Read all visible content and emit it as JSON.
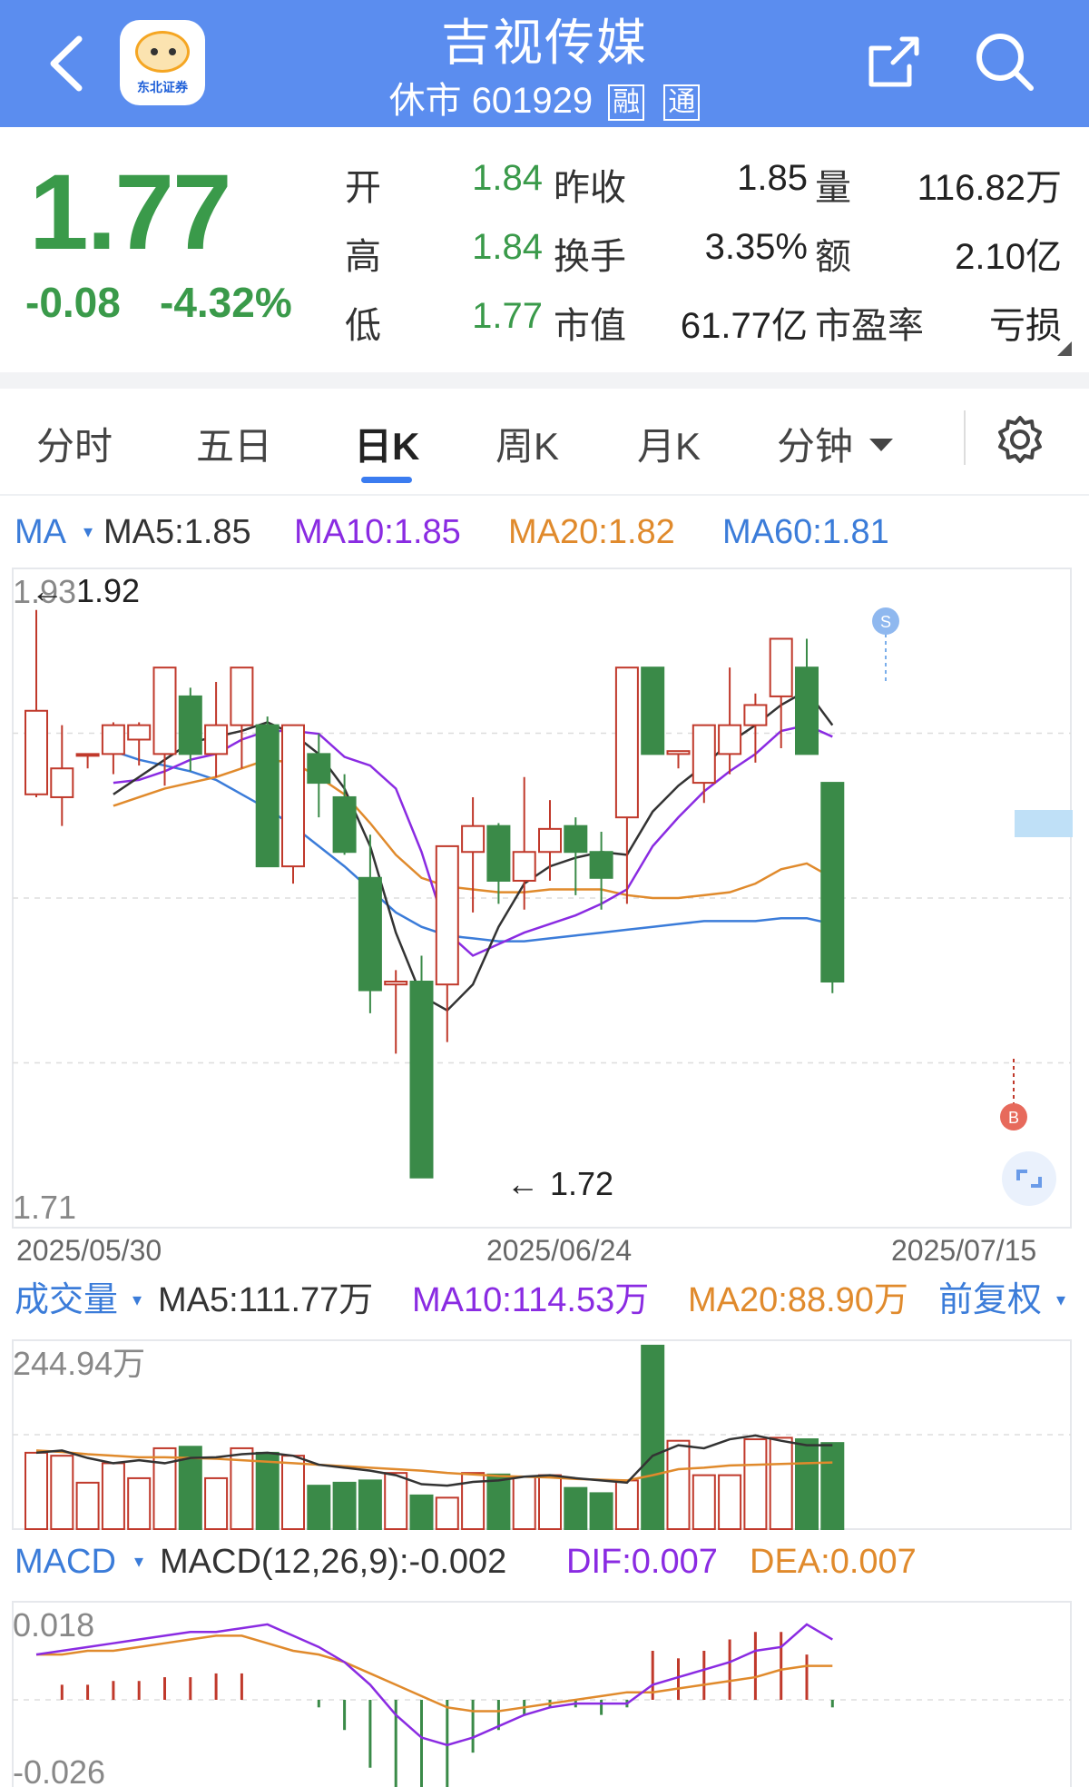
{
  "header": {
    "title": "吉视传媒",
    "status": "休市",
    "code": "601929",
    "tag1": "融",
    "tag2": "通",
    "logo_text": "东北证券"
  },
  "quote": {
    "price": "1.77",
    "change": "-0.08",
    "change_pct": "-4.32%",
    "rows": [
      {
        "l1": "开",
        "v1": "1.84",
        "l2": "昨收",
        "v2": "1.85",
        "l3": "量",
        "v3": "116.82万"
      },
      {
        "l1": "高",
        "v1": "1.84",
        "l2": "换手",
        "v2": "3.35%",
        "l3": "额",
        "v3": "2.10亿"
      },
      {
        "l1": "低",
        "v1": "1.77",
        "l2": "市值",
        "v2": "61.77亿",
        "l3": "市盈率",
        "v3": "亏损"
      }
    ]
  },
  "tabs": [
    "分时",
    "五日",
    "日K",
    "周K",
    "月K",
    "分钟"
  ],
  "active_tab": "日K",
  "colors": {
    "header": "#5b8def",
    "up": "#c0392b",
    "down": "#3a8a48",
    "ma5": "#333333",
    "ma10": "#8a2be2",
    "ma20": "#e08a2c",
    "ma60": "#3b7cd9",
    "accent": "#3b7cf0"
  },
  "kline_legend": {
    "label": "MA",
    "ma5": "MA5:1.85",
    "ma10": "MA10:1.85",
    "ma20": "MA20:1.82",
    "ma60": "MA60:1.81"
  },
  "volume_legend": {
    "label": "成交量",
    "ma5": "MA5:111.77万",
    "ma10": "MA10:114.53万",
    "ma20": "MA20:88.90万",
    "adjust": "前复权"
  },
  "macd_legend": {
    "label": "MACD",
    "macd": "MACD(12,26,9):-0.002",
    "dif": "DIF:0.007",
    "dea": "DEA:0.007"
  },
  "chart_data": {
    "type": "candlestick",
    "y_axis": {
      "top_label": "1.93",
      "bottom_label": "1.71",
      "min": 1.71,
      "max": 1.93
    },
    "x_labels": [
      "2025/05/30",
      "2025/06/24",
      "2025/07/15"
    ],
    "annotations": {
      "high": "1.92",
      "low": "1.72",
      "sell_marker": "S",
      "buy_marker": "B"
    },
    "candles": [
      {
        "o": 1.856,
        "h": 1.92,
        "l": 1.855,
        "c": 1.885
      },
      {
        "o": 1.855,
        "h": 1.88,
        "l": 1.845,
        "c": 1.865
      },
      {
        "o": 1.87,
        "h": 1.87,
        "l": 1.865,
        "c": 1.87
      },
      {
        "o": 1.87,
        "h": 1.881,
        "l": 1.863,
        "c": 1.88
      },
      {
        "o": 1.875,
        "h": 1.881,
        "l": 1.866,
        "c": 1.88
      },
      {
        "o": 1.87,
        "h": 1.89,
        "l": 1.859,
        "c": 1.9
      },
      {
        "o": 1.89,
        "h": 1.893,
        "l": 1.864,
        "c": 1.87
      },
      {
        "o": 1.87,
        "h": 1.895,
        "l": 1.862,
        "c": 1.88
      },
      {
        "o": 1.88,
        "h": 1.895,
        "l": 1.865,
        "c": 1.9
      },
      {
        "o": 1.88,
        "h": 1.883,
        "l": 1.837,
        "c": 1.831
      },
      {
        "o": 1.831,
        "h": 1.88,
        "l": 1.825,
        "c": 1.88
      },
      {
        "o": 1.87,
        "h": 1.877,
        "l": 1.848,
        "c": 1.86
      },
      {
        "o": 1.855,
        "h": 1.863,
        "l": 1.835,
        "c": 1.836
      },
      {
        "o": 1.827,
        "h": 1.842,
        "l": 1.78,
        "c": 1.788
      },
      {
        "o": 1.79,
        "h": 1.795,
        "l": 1.766,
        "c": 1.791
      },
      {
        "o": 1.791,
        "h": 1.8,
        "l": 1.743,
        "c": 1.723
      },
      {
        "o": 1.79,
        "h": 1.836,
        "l": 1.77,
        "c": 1.838
      },
      {
        "o": 1.836,
        "h": 1.855,
        "l": 1.815,
        "c": 1.845
      },
      {
        "o": 1.845,
        "h": 1.846,
        "l": 1.818,
        "c": 1.826
      },
      {
        "o": 1.826,
        "h": 1.862,
        "l": 1.816,
        "c": 1.836
      },
      {
        "o": 1.836,
        "h": 1.854,
        "l": 1.826,
        "c": 1.844
      },
      {
        "o": 1.845,
        "h": 1.848,
        "l": 1.821,
        "c": 1.836
      },
      {
        "o": 1.836,
        "h": 1.843,
        "l": 1.816,
        "c": 1.827
      },
      {
        "o": 1.848,
        "h": 1.9,
        "l": 1.818,
        "c": 1.9
      },
      {
        "o": 1.9,
        "h": 1.88,
        "l": 1.87,
        "c": 1.87
      },
      {
        "o": 1.87,
        "h": 1.87,
        "l": 1.865,
        "c": 1.871
      },
      {
        "o": 1.86,
        "h": 1.878,
        "l": 1.853,
        "c": 1.88
      },
      {
        "o": 1.87,
        "h": 1.9,
        "l": 1.863,
        "c": 1.88
      },
      {
        "o": 1.88,
        "h": 1.891,
        "l": 1.867,
        "c": 1.887
      },
      {
        "o": 1.89,
        "h": 1.91,
        "l": 1.872,
        "c": 1.91
      },
      {
        "o": 1.9,
        "h": 1.91,
        "l": 1.873,
        "c": 1.87
      },
      {
        "o": 1.86,
        "h": 1.855,
        "l": 1.787,
        "c": 1.791
      }
    ],
    "ma": {
      "ma5": [
        1.856,
        1.862,
        1.868,
        1.874,
        1.876,
        1.878,
        1.881,
        1.877,
        1.87,
        1.858,
        1.838,
        1.808,
        1.786,
        1.781,
        1.79,
        1.81,
        1.825,
        1.831,
        1.834,
        1.836,
        1.835,
        1.85,
        1.859,
        1.866,
        1.874,
        1.88,
        1.887,
        1.892,
        1.88
      ],
      "ma10": [
        1.86,
        1.861,
        1.864,
        1.868,
        1.87,
        1.875,
        1.878,
        1.878,
        1.877,
        1.869,
        1.866,
        1.858,
        1.836,
        1.808,
        1.8,
        1.804,
        1.808,
        1.811,
        1.814,
        1.818,
        1.823,
        1.838,
        1.848,
        1.857,
        1.864,
        1.87,
        1.878,
        1.88,
        1.876
      ],
      "ma20": [
        1.852,
        1.855,
        1.858,
        1.86,
        1.862,
        1.865,
        1.868,
        1.867,
        1.862,
        1.856,
        1.846,
        1.835,
        1.827,
        1.824,
        1.823,
        1.822,
        1.822,
        1.823,
        1.823,
        1.823,
        1.821,
        1.82,
        1.82,
        1.821,
        1.822,
        1.825,
        1.83,
        1.832,
        1.827
      ],
      "ma60": [
        1.871,
        1.868,
        1.866,
        1.864,
        1.861,
        1.856,
        1.851,
        1.845,
        1.838,
        1.831,
        1.823,
        1.815,
        1.81,
        1.807,
        1.806,
        1.805,
        1.805,
        1.806,
        1.807,
        1.808,
        1.809,
        1.81,
        1.811,
        1.812,
        1.812,
        1.812,
        1.813,
        1.813,
        1.811
      ]
    },
    "volume": {
      "top_label": "244.94万",
      "max": 244.94,
      "values": [
        102,
        98,
        62,
        88,
        68,
        108,
        110,
        68,
        108,
        102,
        98,
        58,
        62,
        65,
        75,
        45,
        42,
        75,
        73,
        70,
        72,
        55,
        48,
        65,
        245,
        118,
        72,
        72,
        120,
        122,
        120,
        115
      ],
      "ma5": [
        102,
        105,
        95,
        88,
        92,
        88,
        95,
        96,
        100,
        102,
        98,
        86,
        82,
        78,
        72,
        60,
        58,
        63,
        65,
        70,
        72,
        68,
        65,
        62,
        98,
        112,
        108,
        120,
        125,
        118,
        112,
        112
      ],
      "ma20": [
        105,
        103,
        100,
        98,
        96,
        96,
        95,
        94,
        92,
        90,
        88,
        86,
        84,
        82,
        80,
        78,
        75,
        73,
        71,
        70,
        69,
        67,
        66,
        65,
        72,
        80,
        82,
        85,
        86,
        87,
        88,
        89
      ]
    },
    "macd": {
      "top_label": "0.018",
      "bottom_label": "-0.026",
      "dif": [
        0.012,
        0.013,
        0.014,
        0.015,
        0.016,
        0.017,
        0.018,
        0.018,
        0.019,
        0.02,
        0.017,
        0.014,
        0.01,
        0.004,
        -0.004,
        -0.01,
        -0.012,
        -0.01,
        -0.007,
        -0.004,
        -0.002,
        -0.001,
        -0.001,
        -0.001,
        0.004,
        0.006,
        0.008,
        0.01,
        0.013,
        0.014,
        0.02,
        0.016
      ],
      "dea": [
        0.012,
        0.012,
        0.013,
        0.013,
        0.014,
        0.015,
        0.016,
        0.017,
        0.017,
        0.015,
        0.013,
        0.012,
        0.01,
        0.007,
        0.004,
        0.001,
        -0.002,
        -0.003,
        -0.003,
        -0.002,
        -0.001,
        0.0,
        0.001,
        0.002,
        0.002,
        0.003,
        0.004,
        0.005,
        0.006,
        0.008,
        0.009,
        0.009
      ],
      "hist": [
        0.0,
        0.004,
        0.004,
        0.005,
        0.005,
        0.006,
        0.006,
        0.007,
        0.007,
        0.0,
        0.0,
        -0.002,
        -0.008,
        -0.018,
        -0.028,
        -0.034,
        -0.026,
        -0.014,
        -0.008,
        -0.004,
        -0.002,
        -0.002,
        -0.004,
        -0.002,
        0.013,
        0.011,
        0.013,
        0.016,
        0.018,
        0.018,
        0.012,
        -0.002
      ]
    }
  }
}
